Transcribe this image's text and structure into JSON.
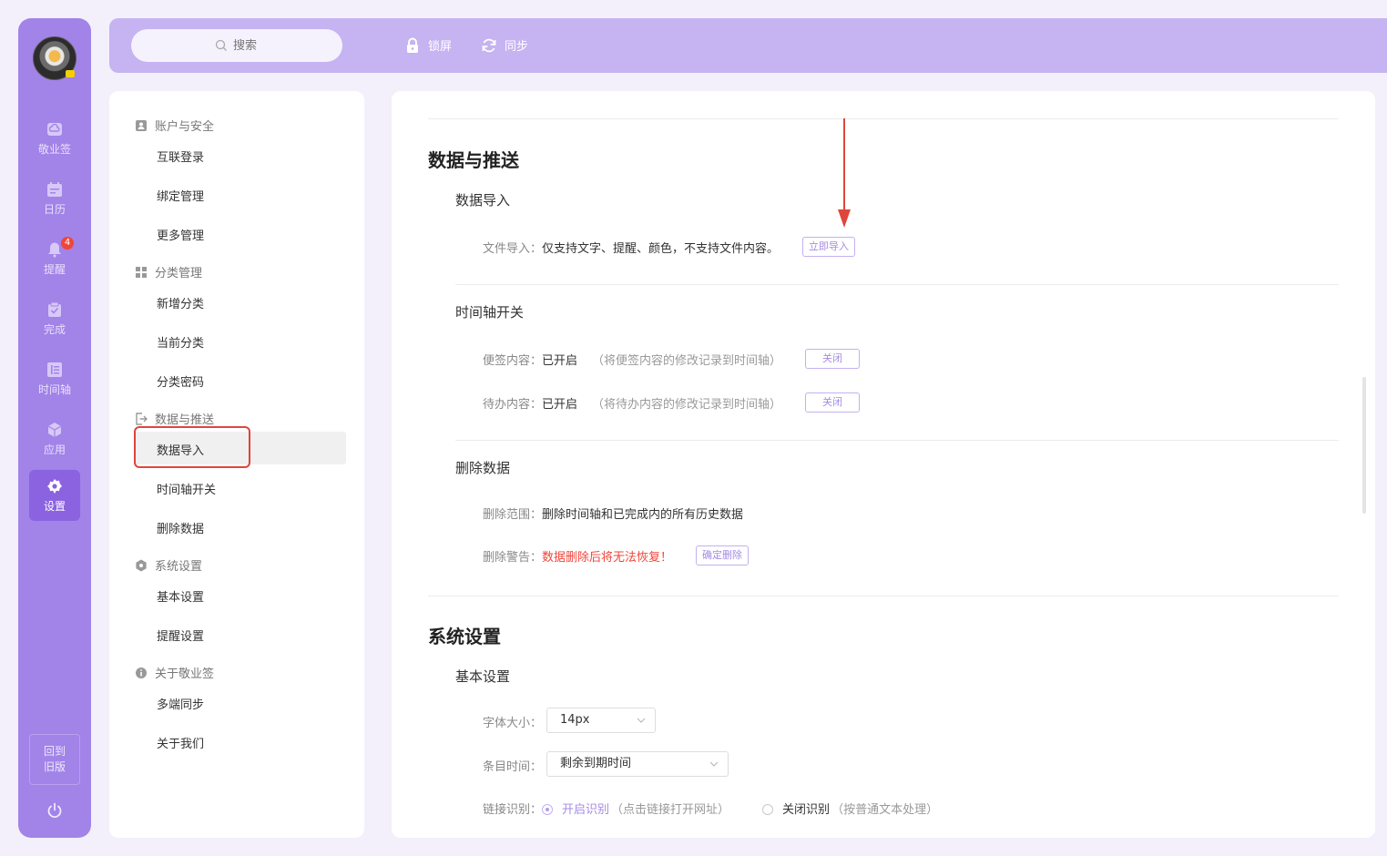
{
  "rail": {
    "items": [
      {
        "label": "敬业签",
        "icon": "cloud-note-icon"
      },
      {
        "label": "日历",
        "icon": "calendar-icon"
      },
      {
        "label": "提醒",
        "icon": "bell-icon",
        "badge": "4"
      },
      {
        "label": "完成",
        "icon": "clipboard-check-icon"
      },
      {
        "label": "时间轴",
        "icon": "timeline-icon"
      },
      {
        "label": "应用",
        "icon": "cube-icon"
      },
      {
        "label": "设置",
        "icon": "gear-icon",
        "active": true
      }
    ],
    "old_version": "回到旧版"
  },
  "topbar": {
    "search_placeholder": "搜索",
    "lock_label": "锁屏",
    "sync_label": "同步"
  },
  "nav": {
    "groups": [
      {
        "title": "账户与安全",
        "icon": "account-icon",
        "items": [
          "互联登录",
          "绑定管理",
          "更多管理"
        ]
      },
      {
        "title": "分类管理",
        "icon": "grid-icon",
        "items": [
          "新增分类",
          "当前分类",
          "分类密码"
        ]
      },
      {
        "title": "数据与推送",
        "icon": "export-icon",
        "items": [
          "数据导入",
          "时间轴开关",
          "删除数据"
        ]
      },
      {
        "title": "系统设置",
        "icon": "gear-icon",
        "items": [
          "基本设置",
          "提醒设置"
        ]
      },
      {
        "title": "关于敬业签",
        "icon": "info-icon",
        "items": [
          "多端同步",
          "关于我们"
        ]
      }
    ],
    "active_item": "数据导入"
  },
  "main": {
    "data_push": {
      "title": "数据与推送",
      "import": {
        "title": "数据导入",
        "label": "文件导入：",
        "text": "仅支持文字、提醒、颜色，不支持文件内容。",
        "button": "立即导入"
      },
      "timeline": {
        "title": "时间轴开关",
        "note_label": "便签内容：",
        "note_status": "已开启",
        "note_hint": "（将便签内容的修改记录到时间轴）",
        "note_button": "关闭",
        "todo_label": "待办内容：",
        "todo_status": "已开启",
        "todo_hint": "（将待办内容的修改记录到时间轴）",
        "todo_button": "关闭"
      },
      "delete": {
        "title": "删除数据",
        "range_label": "删除范围：",
        "range_text": "删除时间轴和已完成内的所有历史数据",
        "warn_label": "删除警告：",
        "warn_text": "数据删除后将无法恢复！",
        "button": "确定删除"
      }
    },
    "system": {
      "title": "系统设置",
      "basic": {
        "title": "基本设置",
        "font_label": "字体大小：",
        "font_value": "14px",
        "time_label": "条目时间：",
        "time_value": "剩余到期时间",
        "link_label": "链接识别：",
        "link_on": "开启识别",
        "link_on_hint": "（点击链接打开网址）",
        "link_off": "关闭识别",
        "link_off_hint": "（按普通文本处理）",
        "link_selected": "开启识别"
      }
    }
  },
  "colors": {
    "rail": "#a283e8",
    "topbar": "#c6b3f1",
    "accent": "#a58be3",
    "warn": "#f0453a",
    "annotation": "#e0453b"
  }
}
